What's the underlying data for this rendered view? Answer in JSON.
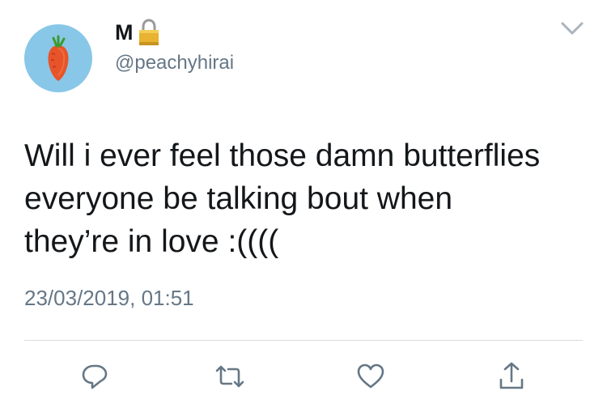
{
  "user": {
    "display_name": "M",
    "handle": "@peachyhirai",
    "protected": true
  },
  "tweet": {
    "text": "Will i ever feel those damn butterflies\neveryone be talking bout when\nthey’re in love :((((",
    "timestamp": "23/03/2019, 01:51"
  },
  "colors": {
    "avatar_bg": "#88c7e8",
    "secondary_text": "#657786",
    "icon": "#657786"
  },
  "icons": {
    "lock": "lock-icon",
    "menu": "chevron-down-icon",
    "reply": "reply-icon",
    "retweet": "retweet-icon",
    "like": "heart-icon",
    "share": "share-icon"
  }
}
